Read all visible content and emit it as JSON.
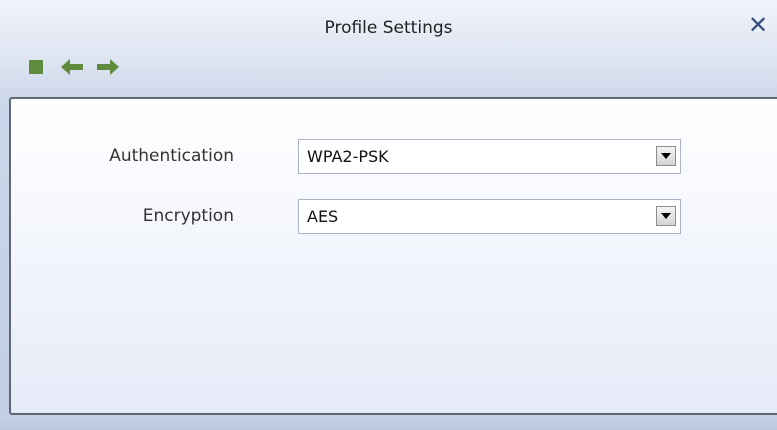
{
  "window": {
    "title": "Profile Settings",
    "close_symbol": "✕"
  },
  "toolbar": {
    "icons": [
      "stop-square-icon",
      "back-arrow-icon",
      "forward-arrow-icon"
    ],
    "icon_color": "#5e8c3c"
  },
  "form": {
    "authentication_label": "Authentication",
    "authentication_value": "WPA2-PSK",
    "encryption_label": "Encryption",
    "encryption_value": "AES"
  },
  "colors": {
    "title_bar_top": "#f1f4fa",
    "panel_border": "#606875",
    "close_icon": "#3a4f80"
  }
}
